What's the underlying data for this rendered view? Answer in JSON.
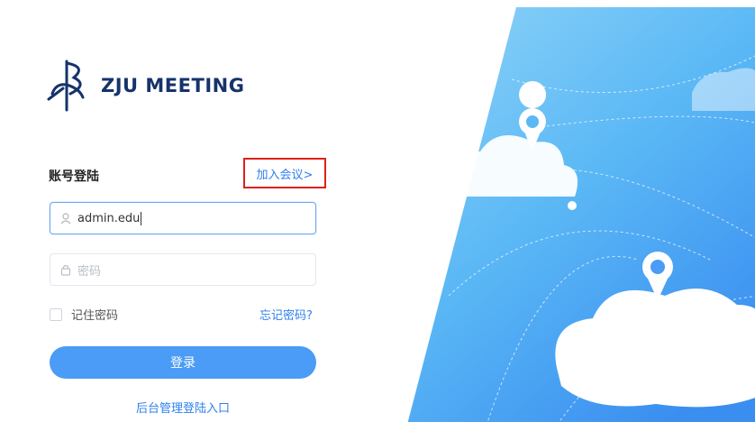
{
  "brand": {
    "name": "ZJU MEETING",
    "color": "#16336b"
  },
  "login": {
    "title": "账号登陆",
    "join_link": "加入会议>",
    "username_value": "admin.edu",
    "password_placeholder": "密码",
    "remember_label": "记住密码",
    "forgot_link": "忘记密码?",
    "submit_label": "登录",
    "admin_link": "后台管理登陆入口"
  },
  "colors": {
    "accent": "#4a9cf6",
    "link": "#2f80ed",
    "highlight_box": "#e0201c",
    "sky": "#5bb8f5"
  }
}
